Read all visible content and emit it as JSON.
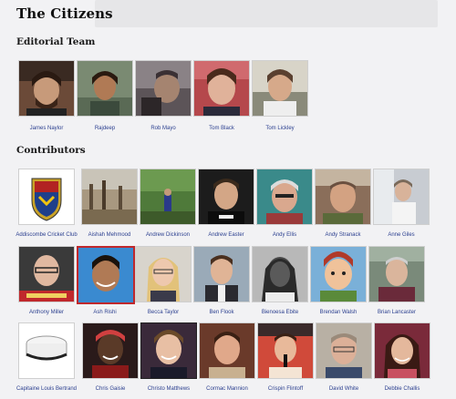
{
  "page": {
    "title": "The Citizens"
  },
  "editorial": {
    "heading": "Editorial Team",
    "people": [
      {
        "name": "James Naylor"
      },
      {
        "name": "Rajdeep"
      },
      {
        "name": "Rob Mayo"
      },
      {
        "name": "Tom Black"
      },
      {
        "name": "Tom Lickley"
      }
    ]
  },
  "contributors": {
    "heading": "Contributors",
    "people": [
      {
        "name": "Addiscombe Cricket Club"
      },
      {
        "name": "Aishah Mehmood"
      },
      {
        "name": "Andrew Dickinson"
      },
      {
        "name": "Andrew Easter"
      },
      {
        "name": "Andy Ellis"
      },
      {
        "name": "Andy Stranack"
      },
      {
        "name": "Anne Giles"
      },
      {
        "name": "Anthony Miller"
      },
      {
        "name": "Ash Rishi"
      },
      {
        "name": "Becca Taylor"
      },
      {
        "name": "Ben Flook"
      },
      {
        "name": "Bienoesa Ebite"
      },
      {
        "name": "Brendan Walsh"
      },
      {
        "name": "Brian Lancaster"
      },
      {
        "name": "Capitaine Louis Bertrand"
      },
      {
        "name": "Chris Gaisie"
      },
      {
        "name": "Christo Matthews"
      },
      {
        "name": "Cormac Mannion"
      },
      {
        "name": "Crispin Flintoff"
      },
      {
        "name": "David White"
      },
      {
        "name": "Debbie Challis"
      }
    ]
  },
  "colors": {
    "link": "#2b3f8f",
    "background": "#f2f2f4"
  }
}
